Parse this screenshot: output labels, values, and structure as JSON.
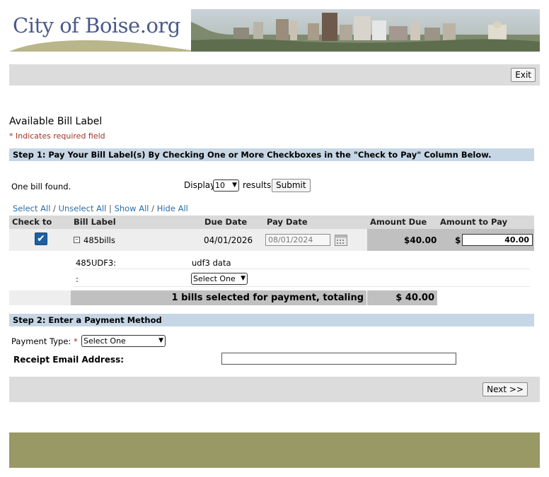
{
  "header": {
    "logo_text": "City of Boise.org"
  },
  "toolbar": {
    "exit_label": "Exit"
  },
  "page": {
    "title": "Available Bill Label",
    "required_note": "* Indicates required field"
  },
  "step1": {
    "title": "Step 1: Pay Your Bill Label(s) By Checking One or More Checkboxes in the \"Check to Pay\" Column Below.",
    "bills_found": "One bill found.",
    "display_label": "Display",
    "display_value": "10",
    "results_label": "results",
    "submit_label": "Submit",
    "links": {
      "select_all": "Select All",
      "unselect_all": "Unselect All",
      "show_all": "Show All",
      "hide_all": "Hide All",
      "sep_slash": "/",
      "sep_pipe": "|"
    }
  },
  "table": {
    "columns": {
      "check": "Check to Pay",
      "label": "Bill Label",
      "due": "Due Date",
      "pay": "Pay Date",
      "amount_due": "Amount Due",
      "amount_to_pay": "Amount to Pay"
    },
    "row": {
      "checked": true,
      "bill_label": "485bills",
      "due_date": "04/01/2026",
      "pay_date": "08/01/2024",
      "amount_due": "$40.00",
      "currency": "$",
      "amount_to_pay": "40.00"
    },
    "details": {
      "udf_label": "485UDF3:",
      "udf_value": "udf3 data",
      "colon": ":",
      "select_value": "Select One"
    },
    "total_text": "1 bills selected for payment, totaling",
    "total_amount": "$ 40.00"
  },
  "step2": {
    "title": "Step 2: Enter a Payment Method",
    "payment_type_label": "Payment Type:",
    "required_star": "*",
    "payment_type_value": "Select One",
    "email_label": "Receipt Email Address:"
  },
  "footer_nav": {
    "next_label": "Next >>"
  },
  "colors": {
    "step_bar": "#c6d6e4",
    "link": "#2a6ea6",
    "required": "#a0322a",
    "footer": "#999966",
    "checkbox": "#1f5fa0"
  }
}
